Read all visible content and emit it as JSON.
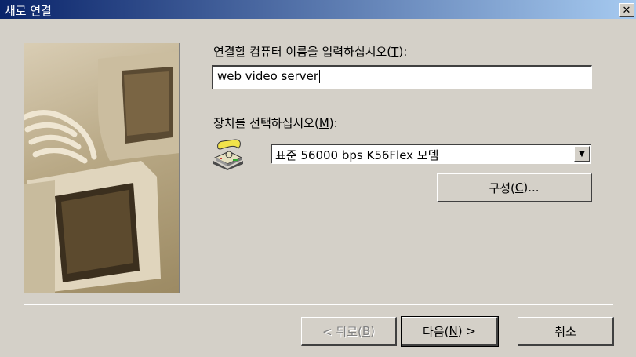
{
  "window": {
    "title": "새로 연결",
    "close_label": "✕"
  },
  "form": {
    "computer_name_label_pre": "연결할 컴퓨터 이름을 입력하십시오(",
    "computer_name_label_key": "T",
    "computer_name_label_post": "):",
    "computer_name_value": "web video server",
    "device_label_pre": "장치를 선택하십시오(",
    "device_label_key": "M",
    "device_label_post": "):",
    "device_selected": "표준 56000 bps K56Flex 모뎀",
    "configure_pre": "구성(",
    "configure_key": "C",
    "configure_post": ")..."
  },
  "footer": {
    "back_pre": "< 뒤로(",
    "back_key": "B",
    "back_post": ")",
    "next_pre": "다음(",
    "next_key": "N",
    "next_post": ") >",
    "cancel_label": "취소"
  },
  "colors": {
    "titlebar_start": "#0a246a",
    "titlebar_end": "#a6caf0",
    "dialog_bg": "#d4d0c8"
  },
  "icons": {
    "device": "telephone-modem-icon",
    "close": "close-icon",
    "dropdown": "chevron-down-icon",
    "illustration": "computer-monitors-illustration"
  }
}
